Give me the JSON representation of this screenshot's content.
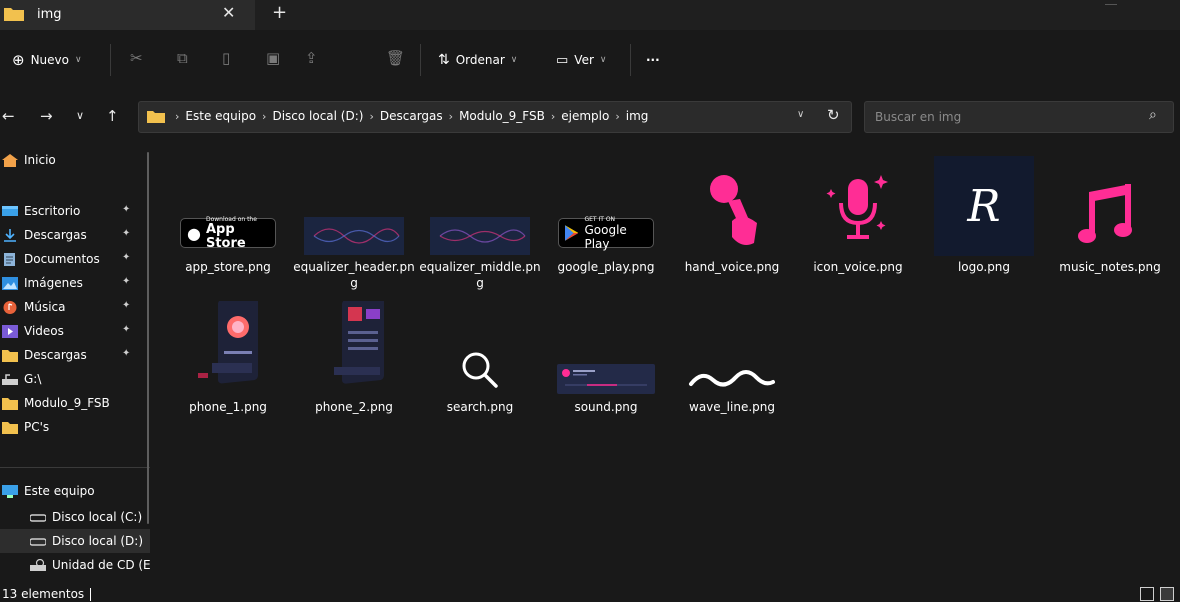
{
  "tab": {
    "title": "img",
    "close": "✕",
    "new": "+"
  },
  "toolbar": {
    "new_label": "Nuevo",
    "sort_label": "Ordenar",
    "view_label": "Ver",
    "more_label": "···"
  },
  "address": {
    "crumbs": [
      "Este equipo",
      "Disco local (D:)",
      "Descargas",
      "Modulo_9_FSB",
      "ejemplo",
      "img"
    ],
    "separator": "›"
  },
  "search": {
    "placeholder": "Buscar en img"
  },
  "sidebar": {
    "items": [
      {
        "label": "Inicio",
        "icon": "home-icon",
        "pinned": false
      },
      {
        "label": "Escritorio",
        "icon": "desktop-icon",
        "pinned": true
      },
      {
        "label": "Descargas",
        "icon": "download-icon",
        "pinned": true
      },
      {
        "label": "Documentos",
        "icon": "documents-icon",
        "pinned": true
      },
      {
        "label": "Imágenes",
        "icon": "pictures-icon",
        "pinned": true
      },
      {
        "label": "Música",
        "icon": "music-icon",
        "pinned": true
      },
      {
        "label": "Videos",
        "icon": "videos-icon",
        "pinned": true
      },
      {
        "label": "Descargas",
        "icon": "folder-icon",
        "pinned": true
      },
      {
        "label": "G:\\",
        "icon": "network-drive-icon",
        "pinned": false
      },
      {
        "label": "Modulo_9_FSB",
        "icon": "folder-icon",
        "pinned": false
      },
      {
        "label": "PC's",
        "icon": "folder-icon",
        "pinned": false
      },
      {
        "label": "Este equipo",
        "icon": "computer-icon",
        "pinned": false
      },
      {
        "label": "Disco local (C:)",
        "icon": "drive-icon",
        "pinned": false
      },
      {
        "label": "Disco local (D:)",
        "icon": "drive-icon",
        "pinned": false
      },
      {
        "label": "Unidad de CD (E",
        "icon": "cd-drive-icon",
        "pinned": false
      }
    ],
    "pin_glyph": "📌"
  },
  "files": [
    {
      "name": "app_store.png",
      "badge_small": "Download on the",
      "badge_big": "App Store"
    },
    {
      "name": "equalizer_header.png"
    },
    {
      "name": "equalizer_middle.png"
    },
    {
      "name": "google_play.png",
      "badge_small": "GET IT ON",
      "badge_big": "Google Play"
    },
    {
      "name": "hand_voice.png"
    },
    {
      "name": "icon_voice.png"
    },
    {
      "name": "logo.png",
      "logo_letter": "R"
    },
    {
      "name": "music_notes.png"
    },
    {
      "name": "phone_1.png"
    },
    {
      "name": "phone_2.png"
    },
    {
      "name": "search.png"
    },
    {
      "name": "sound.png"
    },
    {
      "name": "wave_line.png"
    }
  ],
  "status": {
    "count": "13 elementos"
  },
  "colors": {
    "background": "#191919",
    "accent_pink": "#ff2d95",
    "folder_yellow": "#f2c14e"
  }
}
